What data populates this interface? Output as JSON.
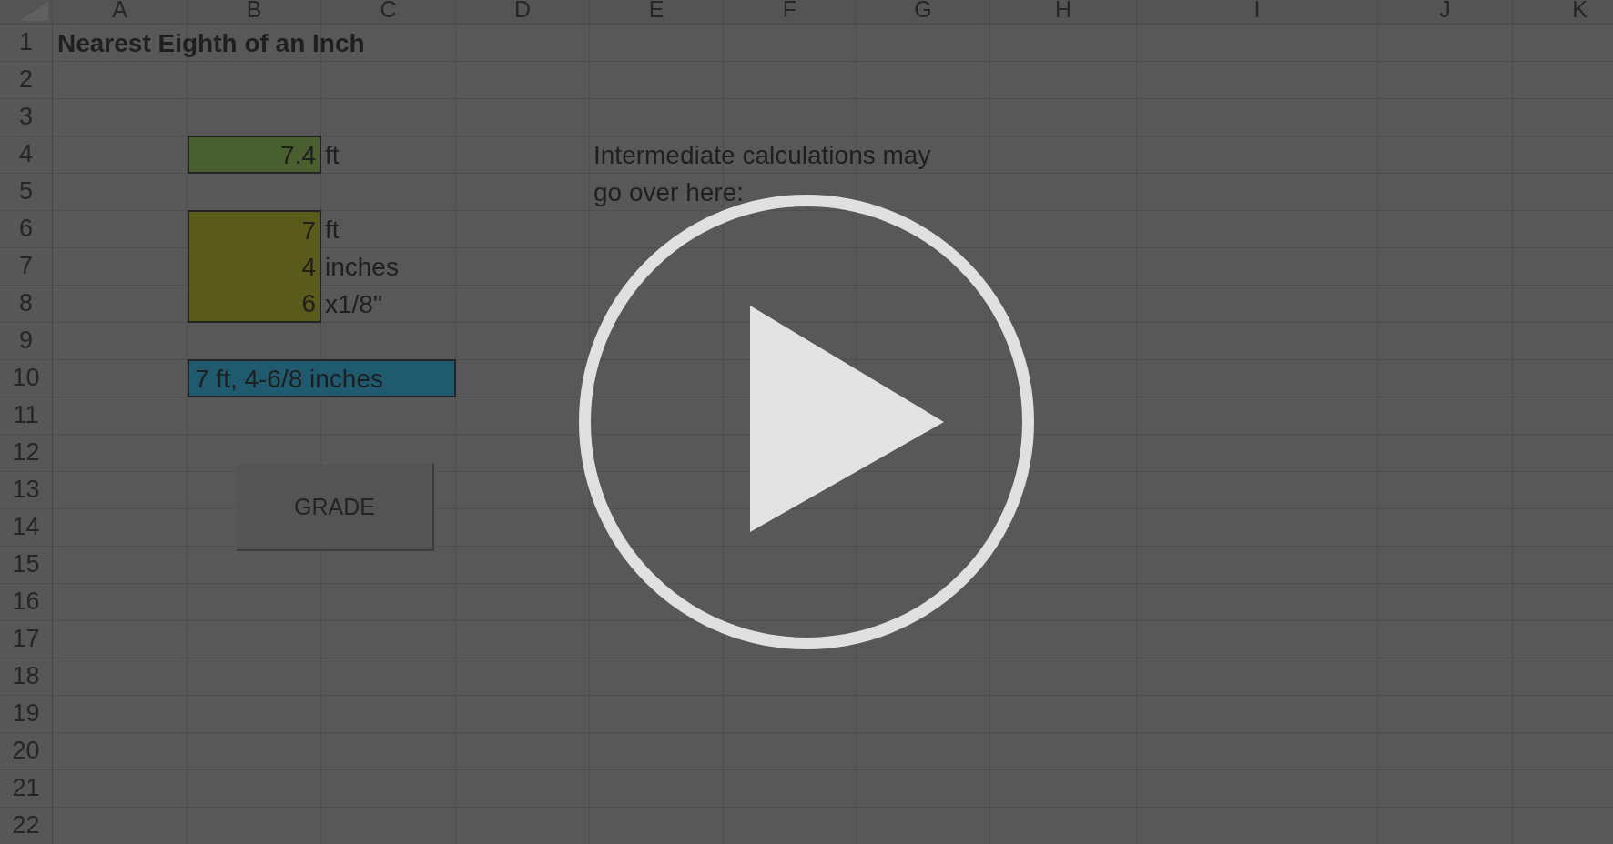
{
  "column_headers": [
    "A",
    "B",
    "C",
    "D",
    "E",
    "F",
    "G",
    "H",
    "I",
    "J",
    "K"
  ],
  "row_headers": [
    "1",
    "2",
    "3",
    "4",
    "5",
    "6",
    "7",
    "8",
    "9",
    "10",
    "11",
    "12",
    "13",
    "14",
    "15",
    "16",
    "17",
    "18",
    "19",
    "20",
    "21",
    "22"
  ],
  "title": "Nearest Eighth of an Inch",
  "input": {
    "value": "7.4",
    "unit": "ft"
  },
  "breakdown": [
    {
      "value": "7",
      "unit": "ft"
    },
    {
      "value": "4",
      "unit": "inches"
    },
    {
      "value": "6",
      "unit": "x1/8\""
    }
  ],
  "result": "7 ft, 4-6/8 inches",
  "note": [
    "Intermediate calculations may",
    "go over here:"
  ],
  "grade_button": {
    "label": "GRADE"
  }
}
